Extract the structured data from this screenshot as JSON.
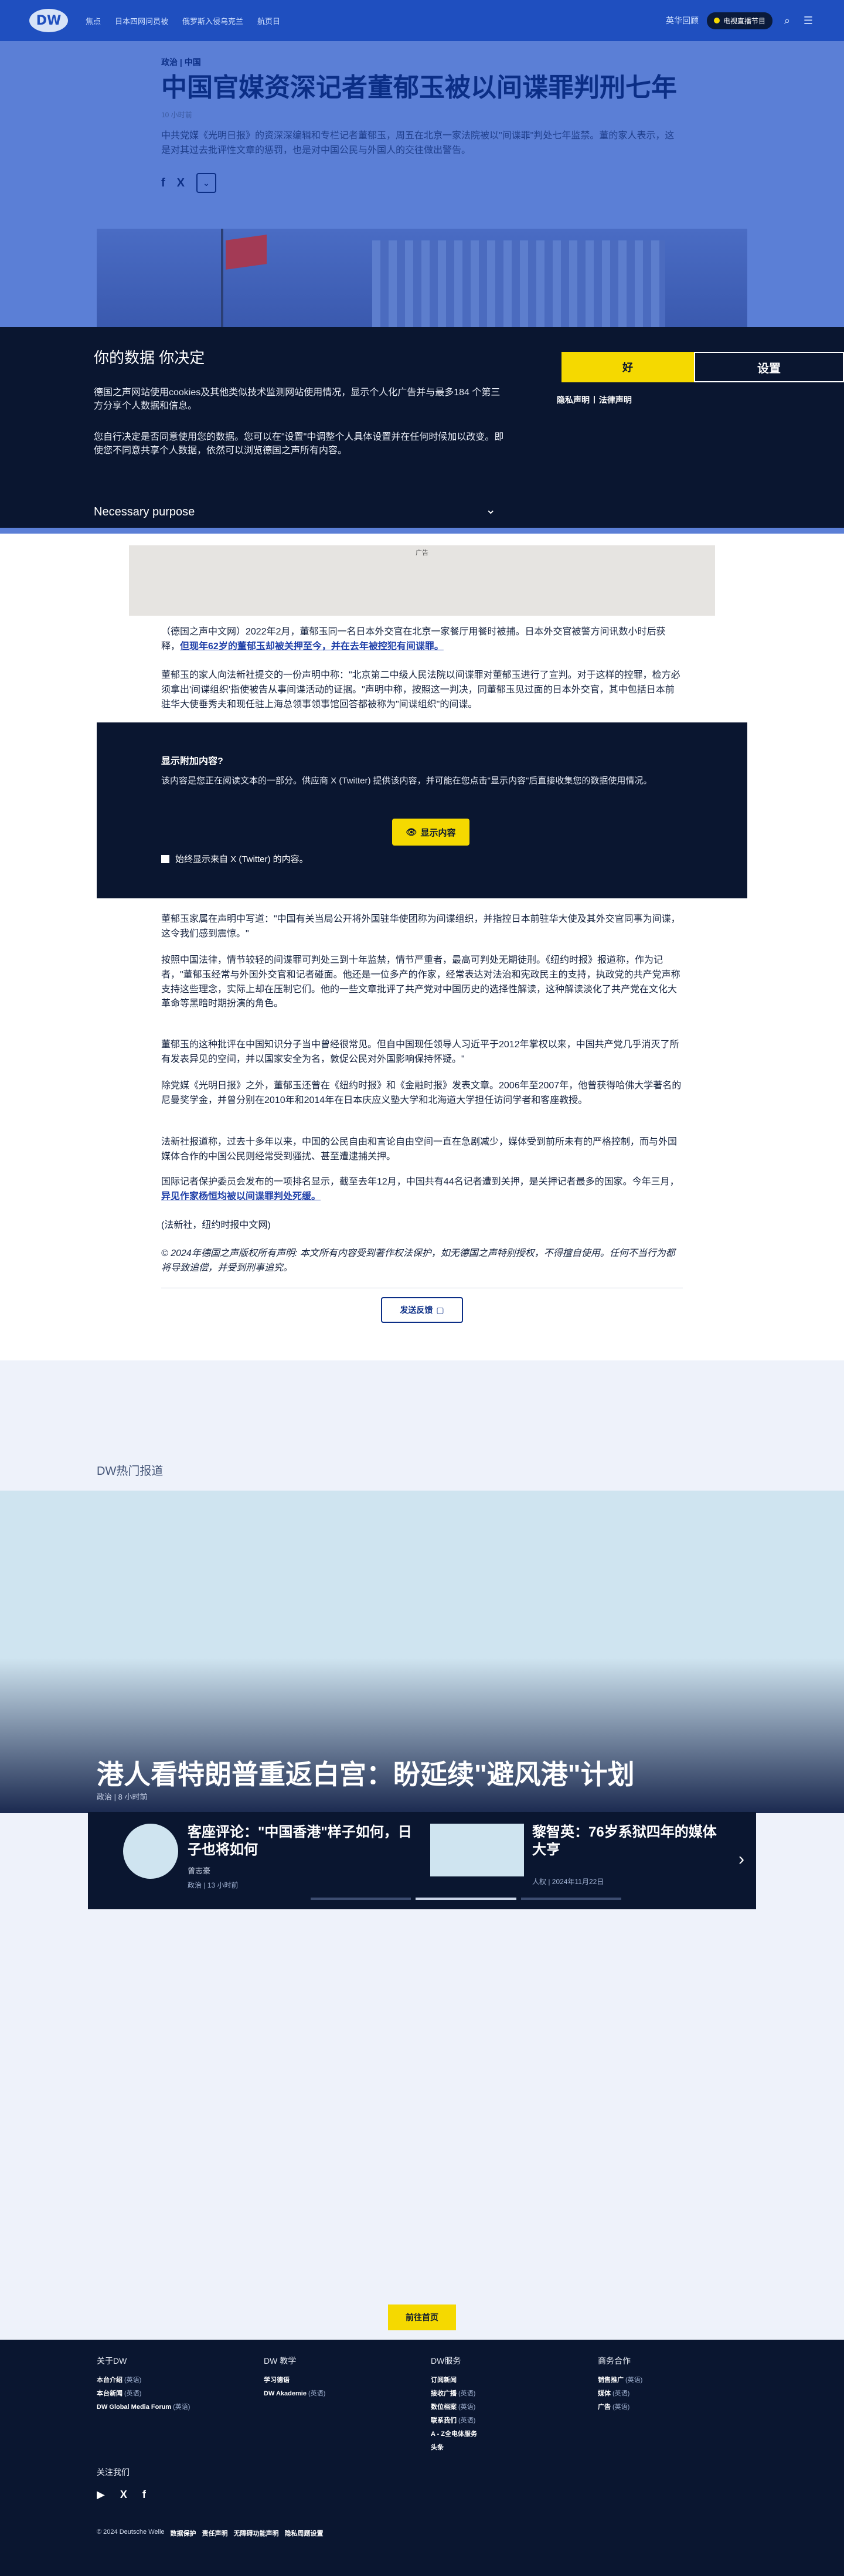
{
  "header": {
    "logo": "DW",
    "nav": [
      "焦点",
      "日本四网问员被",
      "俄罗斯入侵乌克兰",
      "航页日"
    ],
    "lang": "英华回顾",
    "live": "电视直播节目",
    "search_icon": "search-icon",
    "menu_icon": "menu-icon"
  },
  "article": {
    "kicker": "政治 | 中国",
    "headline": "中国官媒资深记者董郁玉被以间谍罪判刑七年",
    "dateline": "10 小时前",
    "lead": "中共党媒《光明日报》的资深深编辑和专栏记者董郁玉，周五在北京一家法院被以\"间谍罪\"判处七年监禁。董的家人表示，这是对其过去批评性文章的惩罚，也是对中国公民与外国人的交往做出警告。",
    "share": [
      "f",
      "X"
    ],
    "share_more": "⌄"
  },
  "cookie": {
    "title": "你的数据 你决定",
    "p1": "德国之声网站使用cookies及其他类似技术监测网站使用情况，显示个人化广告并与最多184 个第三方分享个人数据和信息。",
    "p2": "您自行决定是否同意使用您的数据。您可以在\"设置\"中调整个人具体设置并在任何时候加以改变。即使您不同意共享个人数据，依然可以浏览德国之声所有内容。",
    "purpose": "Necessary purpose",
    "chevron": "⌄",
    "accept": "好",
    "settings": "设置",
    "privacy": "隐私声明",
    "sep": "|",
    "legal": "法律声明"
  },
  "ad_label": "广告",
  "body": {
    "p_a_pre": "（德国之声中文网）2022年2月，董郁玉同一名日本外交官在北京一家餐厅用餐时被捕。日本外交官被警方问讯数小时后获释，",
    "p_a_link": "但现年62岁的董郁玉却被关押至今，并在去年被控犯有间谍罪。",
    "p_b": "董郁玉的家人向法新社提交的一份声明中称：\"北京第二中级人民法院以间谍罪对董郁玉进行了宣判。对于这样的控罪，检方必须拿出'间谍组织'指使被告从事间谍活动的证据。\"声明中称，按照这一判决，同董郁玉见过面的日本外交官，其中包括日本前驻华大使垂秀夫和现任驻上海总领事领事馆回答都被称为\"间谍组织\"的间谍。",
    "embed_title": "显示附加内容?",
    "embed_text": "该内容是您正在阅读文本的一部分。供应商 X (Twitter) 提供该内容，并可能在您点击\"显示内容\"后直接收集您的数据使用情况。",
    "embed_btn": "显示内容",
    "embed_always": "始终显示来自 X (Twitter) 的内容。",
    "p_c": "董郁玉家属在声明中写道：\"中国有关当局公开将外国驻华使团称为间谍组织，并指控日本前驻华大使及其外交官同事为间谍，这令我们感到震惊。\"",
    "p_d": "按照中国法律，情节较轻的间谍罪可判处三到十年监禁，情节严重者，最高可判处无期徒刑。《纽约时报》报道称，作为记者，\"董郁玉经常与外国外交官和记者碰面。他还是一位多产的作家，经常表达对法治和宪政民主的支持，执政党的共产党声称支持这些理念，实际上却在压制它们。他的一些文章批评了共产党对中国历史的选择性解读，这种解读淡化了共产党在文化大革命等黑暗时期扮演的角色。",
    "p_e": "董郁玉的这种批评在中国知识分子当中曾经很常见。但自中国现任领导人习近平于2012年掌权以来，中国共产党几乎消灭了所有发表异见的空间，并以国家安全为名，敦促公民对外国影响保持怀疑。\"",
    "p_f": "除党媒《光明日报》之外，董郁玉还曾在《纽约时报》和《金融时报》发表文章。2006年至2007年，他曾获得哈佛大学著名的尼曼奖学金，并曾分别在2010年和2014年在日本庆应义塾大学和北海道大学担任访问学者和客座教授。",
    "p_g": "法新社报道称，过去十多年以来，中国的公民自由和言论自由空间一直在急剧减少，媒体受到前所未有的严格控制，而与外国媒体合作的中国公民则经常受到骚扰、甚至遭逮捕关押。",
    "p_h_pre": "国际记者保护委员会发布的一项排名显示，截至去年12月，中国共有44名记者遭到关押，是关押记者最多的国家。今年三月，",
    "p_h_link": "异见作家杨恒均被以间谍罪判处死缓。",
    "p_i": "(法新社，纽约时报中文网)",
    "p_j": "© 2024年德国之声版权所有声明: 本文所有内容受到著作权法保护，如无德国之声特别授权，不得擅自使用。任何不当行为都将导致追偿，并受到刑事追究。",
    "feedback": "发送反馈"
  },
  "hot": {
    "label": "DW热门报道",
    "feature_title": "港人看特朗普重返白宫：盼延续\"避风港\"计划",
    "feature_meta": "政治 | 8 小时前",
    "cards": [
      {
        "title": "客座评论：\"中国香港\"样子如何，日子也将如何",
        "author": "曾志豪",
        "meta": "政治 | 13 小时前"
      },
      {
        "title": "黎智英：76岁系狱四年的媒体大亨",
        "meta": "人权 | 2024年11月22日"
      }
    ],
    "next": "›",
    "home": "前往首页"
  },
  "footer": {
    "cols": [
      {
        "title": "关于DW",
        "items": [
          {
            "t": "本台介绍",
            "e": "(英语)"
          },
          {
            "t": "本台新闻",
            "e": "(英语)"
          },
          {
            "t": "DW Global Media Forum",
            "e": "(英语)"
          }
        ]
      },
      {
        "title": "DW 教学",
        "items": [
          {
            "t": "学习德语",
            "e": ""
          },
          {
            "t": "DW Akademie",
            "e": "(英语)"
          }
        ]
      },
      {
        "title": "DW服务",
        "items": [
          {
            "t": "订阅新闻",
            "e": ""
          },
          {
            "t": "接收广播",
            "e": "(英语)"
          },
          {
            "t": "数位档案",
            "e": "(英语)"
          },
          {
            "t": "联系我们",
            "e": "(英语)"
          },
          {
            "t": "A - Z全电体服务",
            "e": ""
          },
          {
            "t": "头条",
            "e": ""
          }
        ]
      },
      {
        "title": "商务合作",
        "items": [
          {
            "t": "销售推广",
            "e": "(英语)"
          },
          {
            "t": "媒体",
            "e": "(英语)"
          },
          {
            "t": "广告",
            "e": "(英语)"
          }
        ]
      }
    ],
    "follow": "关注我们",
    "socials": [
      "▶",
      "X",
      "f"
    ],
    "copyright": "© 2024 Deutsche Welle",
    "links": [
      "数据保护",
      "责任声明",
      "无障碍功能声明",
      "隐私周题设置"
    ]
  }
}
